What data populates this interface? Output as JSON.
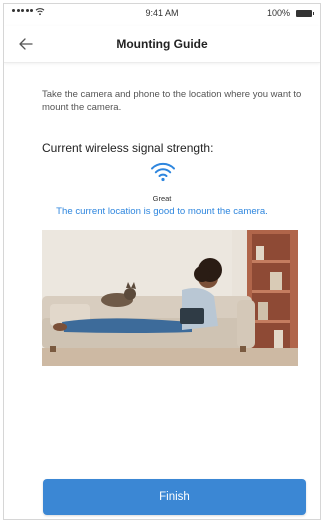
{
  "status_bar": {
    "time": "9:41 AM",
    "battery": "100%"
  },
  "nav": {
    "title": "Mounting Guide",
    "back_icon": "arrow-left-icon"
  },
  "content": {
    "instruction": "Take the camera and phone to the location where you want to mount the camera.",
    "signal_heading": "Current wireless signal strength:",
    "signal_icon": "wifi-icon",
    "signal_level": "Great",
    "signal_message": "The current location is good to mount the camera.",
    "message_color": "#2e86de"
  },
  "actions": {
    "finish_label": "Finish",
    "button_color": "#3b87d4"
  }
}
